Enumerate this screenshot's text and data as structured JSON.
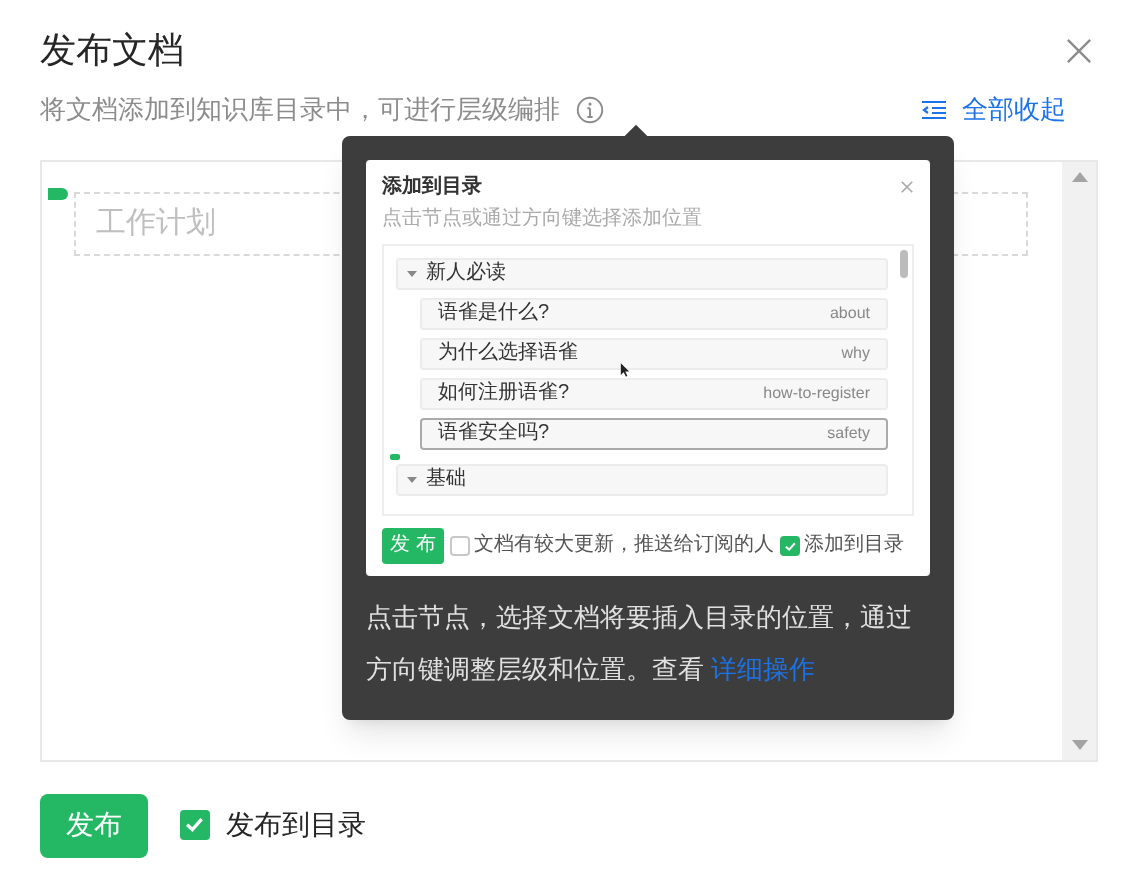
{
  "dialog": {
    "title": "发布文档",
    "subtitle": "将文档添加到知识库目录中，可进行层级编排",
    "collapse_all": "全部收起"
  },
  "editing_node": {
    "placeholder": "工作计划"
  },
  "tooltip": {
    "preview": {
      "title": "添加到目录",
      "subtitle": "点击节点或通过方向键选择添加位置",
      "groups": [
        {
          "title": "新人必读",
          "expanded": true,
          "children": [
            {
              "title": "语雀是什么?",
              "slug": "about",
              "selected": false
            },
            {
              "title": "为什么选择语雀",
              "slug": "why",
              "selected": false
            },
            {
              "title": "如何注册语雀?",
              "slug": "how-to-register",
              "selected": false
            },
            {
              "title": "语雀安全吗?",
              "slug": "safety",
              "selected": true
            }
          ]
        },
        {
          "title": "基础",
          "expanded": true
        }
      ],
      "publish": "发 布",
      "options": [
        {
          "label": "文档有较大更新，推送给订阅的人",
          "checked": false
        },
        {
          "label": "添加到目录",
          "checked": true
        }
      ]
    },
    "text": "点击节点，选择文档将要插入目录的位置，通过方向键调整层级和位置。查看 ",
    "link": "详细操作"
  },
  "footer": {
    "publish": "发布",
    "add_to_catalog": {
      "label": "发布到目录",
      "checked": true
    }
  }
}
